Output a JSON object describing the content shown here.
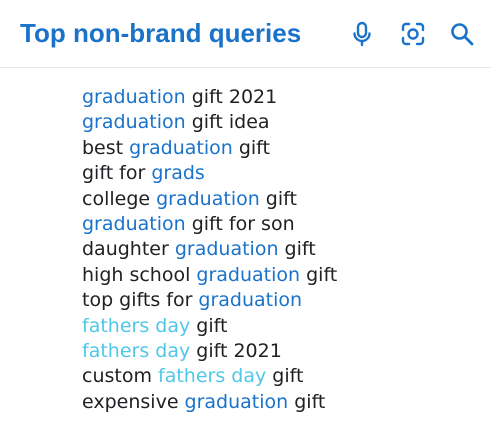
{
  "header": {
    "title": "Top non-brand queries",
    "icons": [
      "microphone-icon",
      "lens-icon",
      "search-icon"
    ],
    "accent_color": "#1a73c9"
  },
  "colors": {
    "highlight_dark": "#1a73c9",
    "highlight_light": "#4ec7e8",
    "text": "#202124"
  },
  "queries": [
    [
      {
        "t": "graduation",
        "s": "brand"
      },
      {
        "t": " gift 2021",
        "s": "plain"
      }
    ],
    [
      {
        "t": "graduation",
        "s": "brand"
      },
      {
        "t": " gift idea",
        "s": "plain"
      }
    ],
    [
      {
        "t": "best ",
        "s": "plain"
      },
      {
        "t": "graduation",
        "s": "brand"
      },
      {
        "t": " gift",
        "s": "plain"
      }
    ],
    [
      {
        "t": "gift for ",
        "s": "plain"
      },
      {
        "t": "grads",
        "s": "brand"
      }
    ],
    [
      {
        "t": "college ",
        "s": "plain"
      },
      {
        "t": "graduation",
        "s": "brand"
      },
      {
        "t": " gift",
        "s": "plain"
      }
    ],
    [
      {
        "t": "graduation",
        "s": "brand"
      },
      {
        "t": " gift for son",
        "s": "plain"
      }
    ],
    [
      {
        "t": "daughter ",
        "s": "plain"
      },
      {
        "t": "graduation",
        "s": "brand"
      },
      {
        "t": " gift",
        "s": "plain"
      }
    ],
    [
      {
        "t": "high school ",
        "s": "plain"
      },
      {
        "t": "graduation",
        "s": "brand"
      },
      {
        "t": " gift",
        "s": "plain"
      }
    ],
    [
      {
        "t": "top gifts for ",
        "s": "plain"
      },
      {
        "t": "graduation",
        "s": "brand"
      }
    ],
    [
      {
        "t": "fathers day",
        "s": "brand-light"
      },
      {
        "t": " gift",
        "s": "plain"
      }
    ],
    [
      {
        "t": "fathers day",
        "s": "brand-light"
      },
      {
        "t": " gift 2021",
        "s": "plain"
      }
    ],
    [
      {
        "t": "custom ",
        "s": "plain"
      },
      {
        "t": "fathers day",
        "s": "brand-light"
      },
      {
        "t": " gift",
        "s": "plain"
      }
    ],
    [
      {
        "t": "expensive ",
        "s": "plain"
      },
      {
        "t": "graduation",
        "s": "brand"
      },
      {
        "t": " gift",
        "s": "plain"
      }
    ]
  ]
}
